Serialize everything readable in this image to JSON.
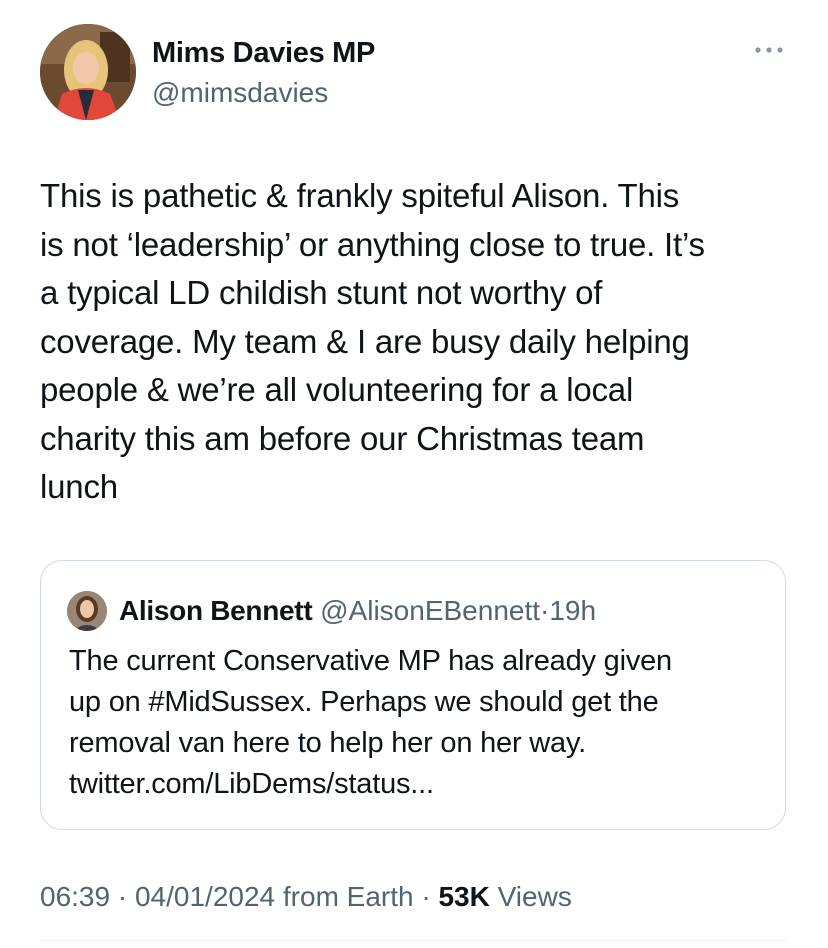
{
  "author": {
    "name": "Mims Davies MP",
    "handle": "@mimsdavies"
  },
  "tweet": {
    "text": "This is pathetic & frankly spiteful Alison. This\nis not ‘leadership’ or anything close to true. It’s\na typical LD childish stunt not worthy of\ncoverage. My team & I are busy daily helping\npeople & we’re all volunteering for a local\ncharity this am before our Christmas team\nlunch"
  },
  "quoted_tweet": {
    "name": "Alison Bennett",
    "handle": "@AlisonEBennett",
    "separator": "·",
    "time": "19h",
    "text": "The current Conservative MP has already given\nup on #MidSussex. Perhaps we should get the\nremoval van here to help her on her way.\ntwitter.com/LibDems/status..."
  },
  "meta": {
    "time": "06:39",
    "sep1": " · ",
    "date": "04/01/2024",
    "source": " from Earth",
    "sep2": " · ",
    "views_count": "53K",
    "views_label": " Views"
  },
  "icons": {
    "more": "more-horizontal-icon"
  },
  "colors": {
    "text_primary": "#0f1419",
    "text_secondary": "#536471",
    "border": "#cfd9de"
  }
}
